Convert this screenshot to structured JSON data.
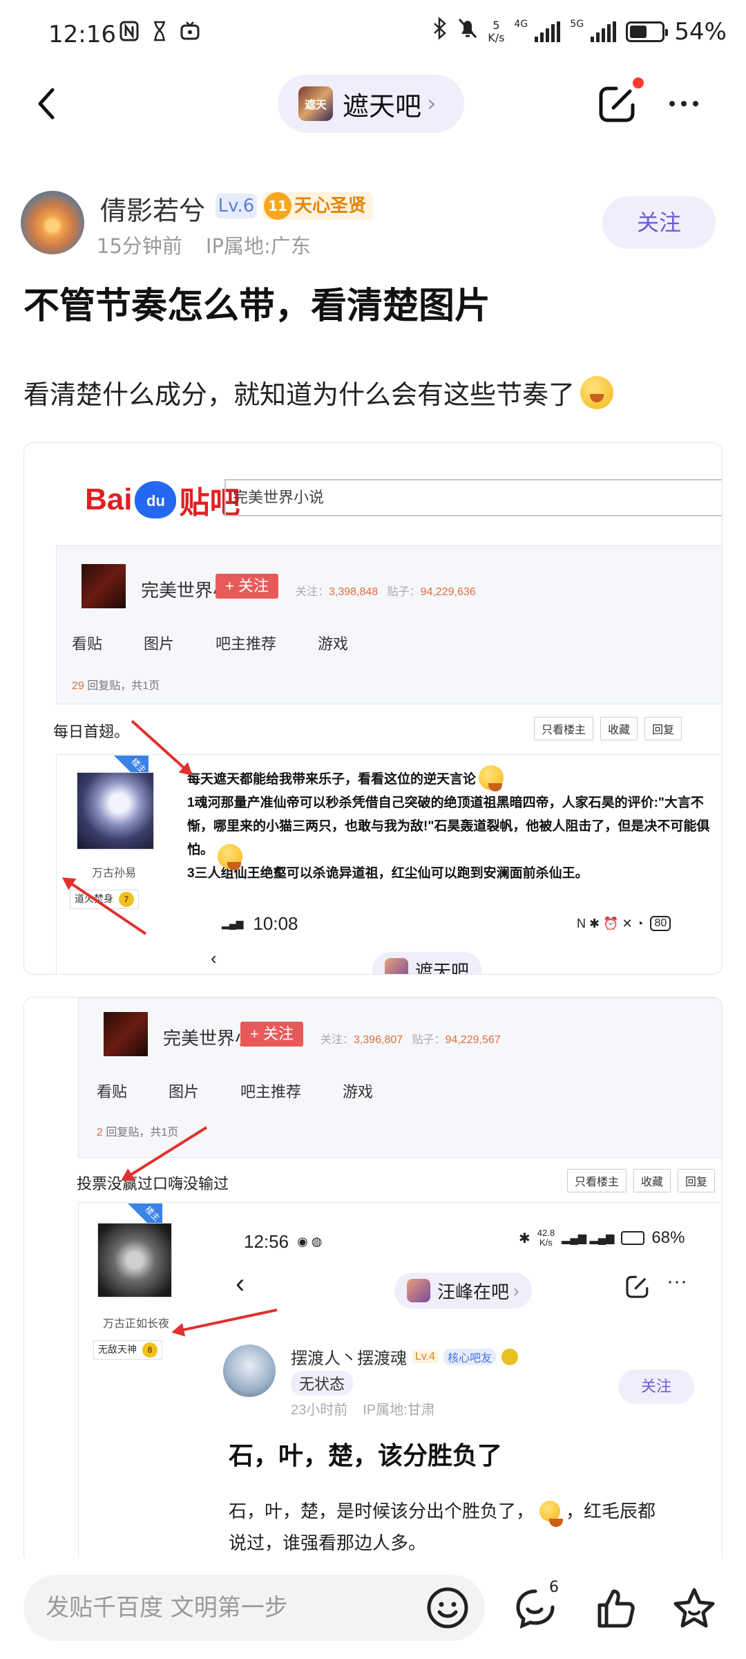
{
  "status_bar": {
    "time": "12:16",
    "net_speed_value": "5",
    "net_speed_unit": "K/s",
    "sig1_label": "4G",
    "sig2_label": "5G",
    "battery": "54%"
  },
  "nav": {
    "forum_icon_text": "遮天",
    "forum_name": "遮天吧",
    "chevron": "›"
  },
  "post": {
    "author": "倩影若兮",
    "level": "Lv.6",
    "title_badge_num": "11",
    "title_badge": "天心圣贤",
    "time_ago": "15分钟前",
    "ip_location": "IP属地:广东",
    "follow_label": "关注",
    "title": "不管节奏怎么带，看清楚图片",
    "body": "看清楚什么成分，就知道为什么会有这些节奏了"
  },
  "image1": {
    "logo_left": "Bai",
    "logo_paw": "du",
    "logo_right": "贴吧",
    "search_text": "完美世界小说",
    "forum_name": "完美世界小说吧",
    "follow": "+ 关注",
    "stats_follow_label": "关注：",
    "stats_follow": "3,398,848",
    "stats_posts_label": "贴子：",
    "stats_posts": "94,229,636",
    "tabs": [
      "看贴",
      "图片",
      "吧主推荐",
      "游戏"
    ],
    "reply_count": "29",
    "reply_suffix": "回复贴，共1页",
    "thread_title": "每日首翅。",
    "buttons": [
      "只看楼主",
      "收藏",
      "回复"
    ],
    "ribbon": "楼主",
    "username": "万古孙易",
    "rank_title": "道火焚身",
    "rank_level": "7",
    "lines": [
      "每天遮天都能给我带来乐子，看看这位的逆天言论",
      "1魂河那量产准仙帝可以秒杀凭借自己突破的绝顶道祖黑暗四帝，人家石昊的评价:\"大言不",
      "惭，哪里来的小猫三两只，也敢与我为敌!\"石昊轰道裂帆，他被人阻击了，但是决不可能俱",
      "怕。",
      "3三人组仙王绝壑可以杀诡异道祖，红尘仙可以跑到安澜面前杀仙王。"
    ],
    "inner_time": "10:08",
    "inner_battery": "80",
    "inner_forum": "遮天吧"
  },
  "image2": {
    "forum_name": "完美世界小说吧",
    "follow": "+ 关注",
    "stats_follow_label": "关注：",
    "stats_follow": "3,396,807",
    "stats_posts_label": "贴子：",
    "stats_posts": "94,229,567",
    "tabs": [
      "看贴",
      "图片",
      "吧主推荐",
      "游戏"
    ],
    "reply_count": "2",
    "reply_suffix": "回复贴，共1页",
    "thread_title": "投票没赢过口嗨没输过",
    "buttons": [
      "只看楼主",
      "收藏",
      "回复"
    ],
    "ribbon": "楼主",
    "username": "万古正如长夜",
    "rank_title": "无敌天神",
    "rank_level": "8",
    "inner_time": "12:56",
    "inner_speed": "42.8",
    "inner_speed_unit": "K/s",
    "inner_battery": "68%",
    "inner_forum": "汪峰在吧",
    "inner_author": "摆渡人丶摆渡魂",
    "inner_level": "Lv.4",
    "inner_badge": "核心吧友",
    "inner_status": "无状态",
    "inner_time_ago": "23小时前",
    "inner_ip": "IP属地:甘肃",
    "inner_follow": "关注",
    "inner_title": "石，叶，楚，该分胜负了",
    "inner_body_1a": "石，叶，楚，是时候该分出个胜负了，",
    "inner_body_1b": "，红毛辰都",
    "inner_body_2": "说过，谁强看那边人多。"
  },
  "bottom": {
    "placeholder": "发贴千百度 文明第一步",
    "comment_count": "6"
  },
  "colors": {
    "accent": "#6a5bd8",
    "follow_bg": "#f1eefc",
    "tieba_red": "#e02020",
    "tieba_blue": "#2468f2",
    "arrow_red": "#e0312e"
  }
}
